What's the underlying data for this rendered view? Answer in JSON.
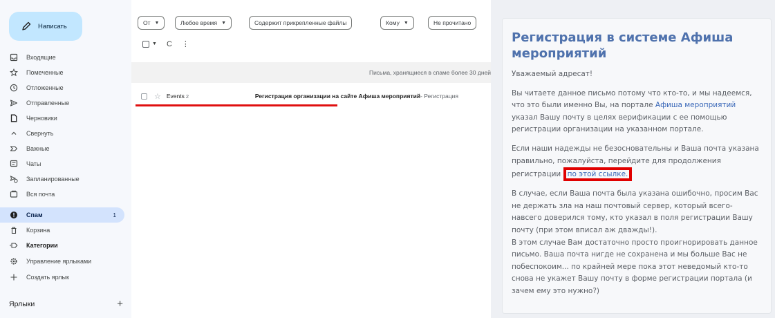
{
  "sidebar": {
    "compose_label": "Написать",
    "items": [
      {
        "label": "Входящие",
        "icon": "inbox-icon"
      },
      {
        "label": "Помеченные",
        "icon": "star-icon"
      },
      {
        "label": "Отложенные",
        "icon": "clock-icon"
      },
      {
        "label": "Отправленные",
        "icon": "send-icon"
      },
      {
        "label": "Черновики",
        "icon": "draft-icon"
      },
      {
        "label": "Свернуть",
        "icon": "chevron-up-icon"
      },
      {
        "label": "Важные",
        "icon": "important-icon"
      },
      {
        "label": "Чаты",
        "icon": "chat-icon"
      },
      {
        "label": "Запланированные",
        "icon": "scheduled-icon"
      },
      {
        "label": "Вся почта",
        "icon": "all-mail-icon"
      },
      {
        "label": "Спам",
        "icon": "spam-icon",
        "count": "1"
      },
      {
        "label": "Корзина",
        "icon": "trash-icon"
      },
      {
        "label": "Категории",
        "icon": "label-icon"
      },
      {
        "label": "Управление ярлыками",
        "icon": "gear-icon"
      },
      {
        "label": "Создать ярлык",
        "icon": "plus-icon"
      }
    ],
    "labels_heading": "Ярлыки",
    "labels_add": "+"
  },
  "filters": {
    "from": "От",
    "any_time": "Любое время",
    "has_attachment": "Содержит прикрепленные файлы",
    "to": "Кому",
    "unread": "Не прочитано"
  },
  "toolbar": {
    "refresh": "C",
    "more": "⋮"
  },
  "spam_banner": "Письма, хранящиеся в спаме более 30 дней",
  "mail": {
    "sender": "Events",
    "count": "2",
    "subject": "Регистрация организации на сайте Афиша мероприятий",
    "snippet": " - Регистрация"
  },
  "email": {
    "title": "Регистрация в системе Афиша мероприятий",
    "greeting": "Уважаемый адресат!",
    "p1_before": "Вы читаете данное письмо потому что кто-то, и мы надеемся, что это были именно Вы, на портале ",
    "p1_link": "Афиша мероприятий",
    "p1_after": " указал Вашу почту в целях верификации с ее помощью регистрации организации на указанном портале.",
    "p2_before": "Если наши надежды не безосновательны и Ваша почта указана правильно, пожалуйста, перейдите для продолжения регистрации ",
    "p2_link": "по этой ссылке.",
    "p3": "В случае, если Ваша почта была указана ошибочно, просим Вас не держать зла на наш почтовый сервер, который всего-навсего доверился тому, кто указал в поля регистрации Вашу почту (при этом вписал аж дважды!).",
    "p4": "В этом случае Вам достаточно просто проигнорировать данное письмо. Ваша почта нигде не сохранена и мы больше Вас не побеспокоим... по крайней мере пока этот неведомый кто-то снова не укажет Вашу почту в форме регистрации портала (и зачем ему это нужно?)"
  },
  "colors": {
    "accent_blue": "#4f72ad",
    "highlight_red": "#e00000",
    "compose_bg": "#c2e7ff",
    "active_item_bg": "#d3e3fd"
  }
}
